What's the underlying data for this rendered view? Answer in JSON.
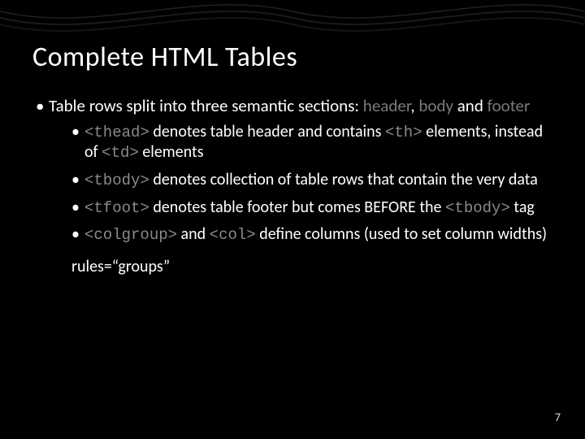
{
  "slide": {
    "title": "Complete HTML Tables",
    "page_number": "7",
    "bullets": [
      {
        "segments": [
          {
            "text": "Table rows split into three semantic sections: ",
            "cls": ""
          },
          {
            "text": "header",
            "cls": "dim"
          },
          {
            "text": ", ",
            "cls": ""
          },
          {
            "text": "body",
            "cls": "dim"
          },
          {
            "text": " and ",
            "cls": ""
          },
          {
            "text": "footer",
            "cls": "dim"
          }
        ],
        "children": [
          {
            "segments": [
              {
                "text": "<thead>",
                "cls": "code"
              },
              {
                "text": " denotes table header and contains ",
                "cls": ""
              },
              {
                "text": "<th>",
                "cls": "code"
              },
              {
                "text": " elements, instead of ",
                "cls": ""
              },
              {
                "text": "<td>",
                "cls": "code"
              },
              {
                "text": " elements",
                "cls": ""
              }
            ]
          },
          {
            "segments": [
              {
                "text": "<tbody>",
                "cls": "code"
              },
              {
                "text": " denotes collection of table rows that contain the very data",
                "cls": ""
              }
            ]
          },
          {
            "segments": [
              {
                "text": "<tfoot>",
                "cls": "code"
              },
              {
                "text": " denotes table footer but comes BEFORE the ",
                "cls": ""
              },
              {
                "text": "<tbody>",
                "cls": "code"
              },
              {
                "text": " tag",
                "cls": ""
              }
            ]
          },
          {
            "segments": [
              {
                "text": "<colgroup>",
                "cls": "code"
              },
              {
                "text": " and ",
                "cls": ""
              },
              {
                "text": "<col>",
                "cls": "code"
              },
              {
                "text": " define columns (used to set column widths)",
                "cls": ""
              }
            ]
          }
        ]
      }
    ],
    "extra_note": "rules=“groups”"
  }
}
